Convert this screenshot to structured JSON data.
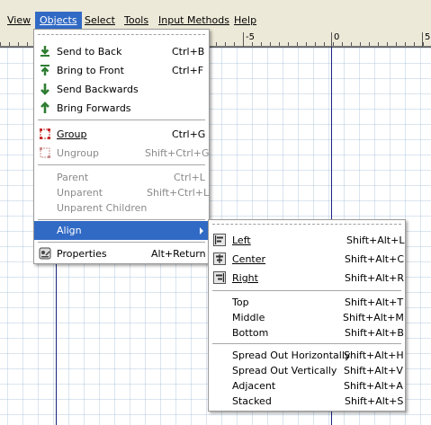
{
  "menubar": {
    "items": [
      {
        "label": "View"
      },
      {
        "label": "Objects"
      },
      {
        "label": "Select"
      },
      {
        "label": "Tools"
      },
      {
        "label": "Input Methods"
      },
      {
        "label": "Help"
      }
    ],
    "active": "Objects"
  },
  "ruler": {
    "labels": [
      "-5",
      "0",
      "5"
    ]
  },
  "objects_menu": {
    "items": [
      {
        "label": "Send to Back",
        "accel": "Ctrl+B",
        "icon": "send-to-back-icon",
        "enabled": true
      },
      {
        "label": "Bring to Front",
        "accel": "Ctrl+F",
        "icon": "bring-to-front-icon",
        "enabled": true
      },
      {
        "label": "Send Backwards",
        "accel": "",
        "icon": "send-backwards-icon",
        "enabled": true
      },
      {
        "label": "Bring Forwards",
        "accel": "",
        "icon": "bring-forwards-icon",
        "enabled": true
      },
      {
        "label": "Group",
        "accel": "Ctrl+G",
        "icon": "group-icon",
        "enabled": true
      },
      {
        "label": "Ungroup",
        "accel": "Shift+Ctrl+G",
        "icon": "ungroup-icon",
        "enabled": false
      },
      {
        "label": "Parent",
        "accel": "Ctrl+L",
        "enabled": false
      },
      {
        "label": "Unparent",
        "accel": "Shift+Ctrl+L",
        "enabled": false
      },
      {
        "label": "Unparent Children",
        "accel": "",
        "enabled": false
      },
      {
        "label": "Align",
        "accel": "",
        "enabled": true,
        "submenu": true
      },
      {
        "label": "Properties",
        "accel": "Alt+Return",
        "icon": "properties-icon",
        "enabled": true
      }
    ]
  },
  "align_menu": {
    "items": [
      {
        "label": "Left",
        "accel": "Shift+Alt+L",
        "icon": "align-left-icon"
      },
      {
        "label": "Center",
        "accel": "Shift+Alt+C",
        "icon": "align-center-icon"
      },
      {
        "label": "Right",
        "accel": "Shift+Alt+R",
        "icon": "align-right-icon"
      },
      {
        "label": "Top",
        "accel": "Shift+Alt+T"
      },
      {
        "label": "Middle",
        "accel": "Shift+Alt+M"
      },
      {
        "label": "Bottom",
        "accel": "Shift+Alt+B"
      },
      {
        "label": "Spread Out Horizontally",
        "accel": "Shift+Alt+H"
      },
      {
        "label": "Spread Out Vertically",
        "accel": "Shift+Alt+V"
      },
      {
        "label": "Adjacent",
        "accel": "Shift+Alt+A"
      },
      {
        "label": "Stacked",
        "accel": "Shift+Alt+S"
      }
    ]
  },
  "colors": {
    "highlight": "#316ac5",
    "menubar_bg": "#ece9d8",
    "guide": "#1a237e",
    "icon_green": "#2e7d32"
  }
}
